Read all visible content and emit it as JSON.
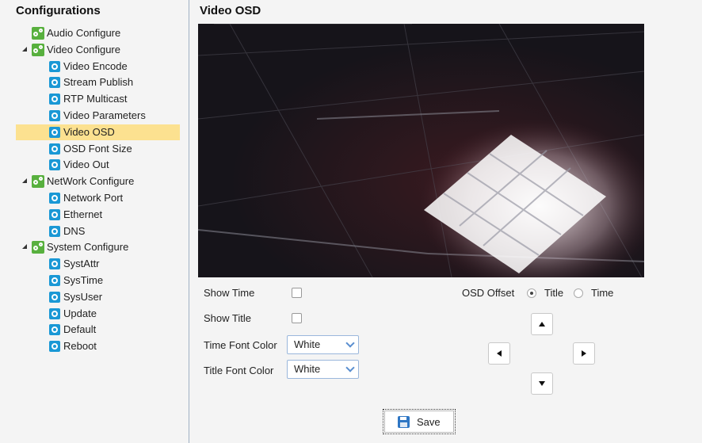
{
  "sidebar": {
    "title": "Configurations",
    "items": [
      {
        "label": "Audio Configure",
        "level": 0,
        "icon": "gears-icon",
        "expandable": false
      },
      {
        "label": "Video Configure",
        "level": 0,
        "icon": "gears-icon",
        "expandable": true
      },
      {
        "label": "Video Encode",
        "level": 1,
        "icon": "gear-icon"
      },
      {
        "label": "Stream Publish",
        "level": 1,
        "icon": "gear-icon"
      },
      {
        "label": "RTP Multicast",
        "level": 1,
        "icon": "gear-icon"
      },
      {
        "label": "Video Parameters",
        "level": 1,
        "icon": "gear-icon"
      },
      {
        "label": "Video OSD",
        "level": 1,
        "icon": "gear-icon",
        "selected": true
      },
      {
        "label": "OSD Font Size",
        "level": 1,
        "icon": "gear-icon"
      },
      {
        "label": "Video Out",
        "level": 1,
        "icon": "gear-icon"
      },
      {
        "label": "NetWork Configure",
        "level": 0,
        "icon": "gears-icon",
        "expandable": true
      },
      {
        "label": "Network Port",
        "level": 1,
        "icon": "gear-icon"
      },
      {
        "label": "Ethernet",
        "level": 1,
        "icon": "gear-icon"
      },
      {
        "label": "DNS",
        "level": 1,
        "icon": "gear-icon"
      },
      {
        "label": "System Configure",
        "level": 0,
        "icon": "gears-icon",
        "expandable": true
      },
      {
        "label": "SystAttr",
        "level": 1,
        "icon": "gear-icon"
      },
      {
        "label": "SysTime",
        "level": 1,
        "icon": "gear-icon"
      },
      {
        "label": "SysUser",
        "level": 1,
        "icon": "gear-icon"
      },
      {
        "label": "Update",
        "level": 1,
        "icon": "gear-icon"
      },
      {
        "label": "Default",
        "level": 1,
        "icon": "gear-icon"
      },
      {
        "label": "Reboot",
        "level": 1,
        "icon": "gear-icon"
      }
    ]
  },
  "main": {
    "title": "Video OSD",
    "show_time_label": "Show Time",
    "show_time_checked": false,
    "show_title_label": "Show Title",
    "show_title_checked": false,
    "time_font_color_label": "Time Font Color",
    "time_font_color_value": "White",
    "title_font_color_label": "Title Font Color",
    "title_font_color_value": "White",
    "osd_offset_label": "OSD Offset",
    "osd_offset_options": [
      "Title",
      "Time"
    ],
    "osd_offset_selected": "Title",
    "save_label": "Save"
  },
  "colors": {
    "selected_row": "#fce190",
    "tree_group_icon": "#58b03e",
    "tree_item_icon": "#1a98d5",
    "select_border": "#9ab7dc"
  }
}
